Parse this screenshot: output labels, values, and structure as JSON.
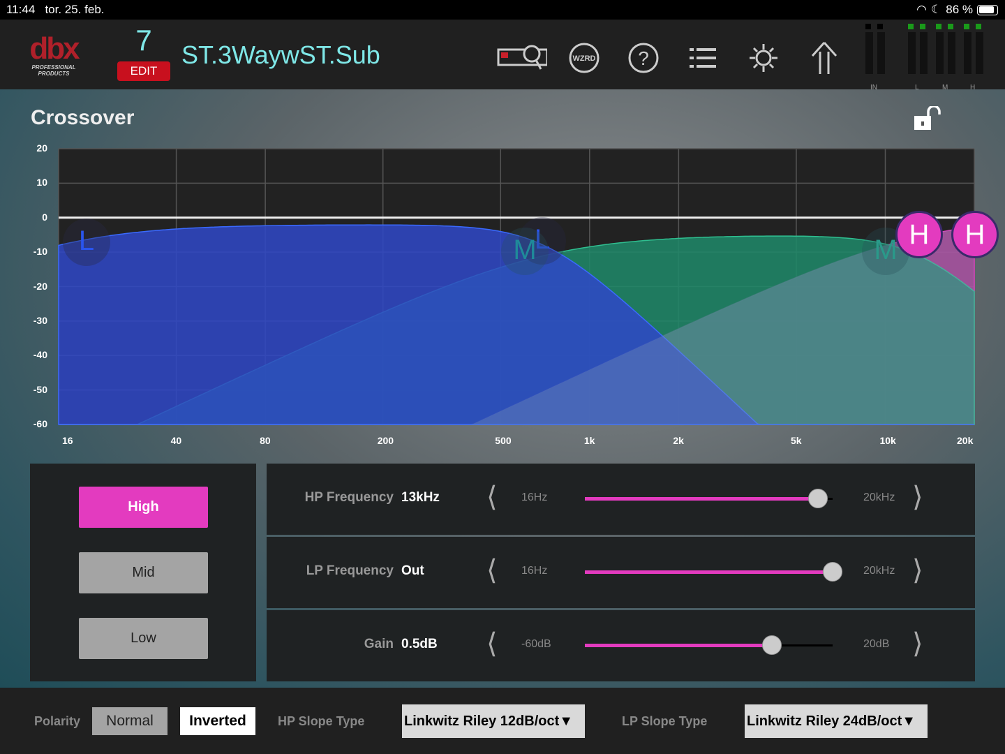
{
  "status": {
    "time": "11:44",
    "date": "tor. 25. feb.",
    "battery": "86 %",
    "battery_level": 0.86
  },
  "header": {
    "logo": "dbx",
    "logo_sub": "PROFESSIONAL PRODUCTS",
    "preset_number": "7",
    "edit_label": "EDIT",
    "preset_name": "ST.3WaywST.Sub",
    "wizard_label": "WZRD",
    "meter_labels": [
      "IN",
      "L",
      "M",
      "H"
    ]
  },
  "page": {
    "title": "Crossover"
  },
  "chart_data": {
    "type": "area",
    "title": "Crossover",
    "y_ticks": [
      "20",
      "10",
      "0",
      "-10",
      "-20",
      "-30",
      "-40",
      "-50",
      "-60"
    ],
    "x_ticks": [
      "16",
      "40",
      "80",
      "200",
      "500",
      "1k",
      "2k",
      "5k",
      "10k",
      "20k"
    ],
    "ylim": [
      -60,
      20
    ],
    "xlim": [
      16,
      20000
    ],
    "bands": [
      {
        "name": "Low",
        "handle": "L",
        "gain_db": -2,
        "hp_hz": 16,
        "hp_order": 2,
        "lp_hz": 700,
        "lp_order": 4,
        "color": "#2f48c8"
      },
      {
        "name": "Mid",
        "handle": "M",
        "gain_db": -5,
        "hp_hz": 700,
        "hp_order": 2,
        "lp_hz": 13000,
        "lp_order": 4,
        "color": "#1f8a6a"
      },
      {
        "name": "High",
        "handle": "H",
        "gain_db": 0.5,
        "hp_hz": 13000,
        "hp_order": 2,
        "lp_hz": null,
        "lp_order": 4,
        "color": "#c0309a"
      }
    ]
  },
  "bands": {
    "buttons": [
      "High",
      "Mid",
      "Low"
    ],
    "selected": "High"
  },
  "params": [
    {
      "label": "HP Frequency",
      "value": "13kHz",
      "min": "16Hz",
      "max": "20kHz",
      "fraction": 0.94
    },
    {
      "label": "LP Frequency",
      "value": "Out",
      "min": "16Hz",
      "max": "20kHz",
      "fraction": 1.0
    },
    {
      "label": "Gain",
      "value": "0.5dB",
      "min": "-60dB",
      "max": "20dB",
      "fraction": 0.756
    }
  ],
  "bottom": {
    "polarity_label": "Polarity",
    "normal": "Normal",
    "inverted": "Inverted",
    "polarity_selected": "Inverted",
    "hp_slope_label": "HP Slope Type",
    "hp_slope": "Linkwitz Riley 12dB/oct",
    "lp_slope_label": "LP Slope Type",
    "lp_slope": "Linkwitz Riley 24dB/oct"
  },
  "colors": {
    "accent": "#e33bbf",
    "cyan": "#7fe8e8",
    "edit": "#c8101e"
  }
}
